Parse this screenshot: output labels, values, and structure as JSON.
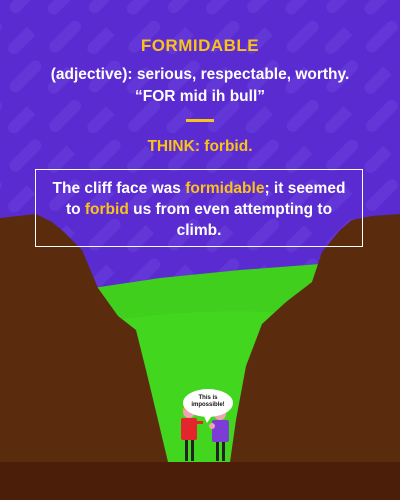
{
  "title": "FORMIDABLE",
  "definition": "(adjective): serious, respectable, worthy.",
  "pronunciation": "“FOR mid ih bull”",
  "think": "THINK: forbid.",
  "sentence": {
    "part1": "The cliff face was ",
    "highlight1": "formidable",
    "part2": "; it seemed to ",
    "highlight2": "forbid",
    "part3": " us from even attempting to climb."
  },
  "speech_bubble": "This is impossible!",
  "colors": {
    "background": "#5a2bd0",
    "accent": "#f9c31a",
    "grass": "#3fcf1c",
    "cliff": "#5a2c0d",
    "ground": "#4a1e08"
  }
}
